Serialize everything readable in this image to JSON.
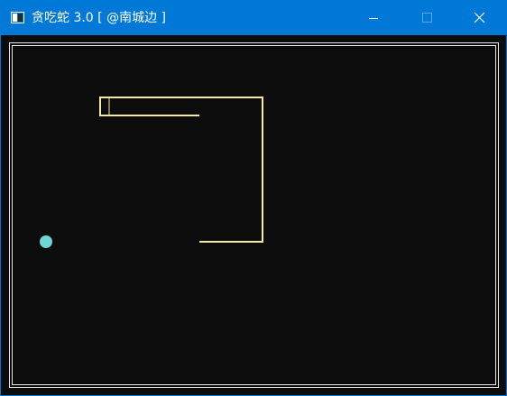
{
  "window": {
    "title": "贪吃蛇 3.0 [ @南城边 ]",
    "titlebar_color": "#0078d7"
  },
  "controls": {
    "minimize_icon": "minimize-icon",
    "maximize_icon": "maximize-icon",
    "close_icon": "close-icon"
  },
  "game": {
    "border_color": "#e8e8e8",
    "snake_color": "#f5eb9a",
    "food_color": "#6fd5d5",
    "background_color": "#0c0c0c"
  }
}
